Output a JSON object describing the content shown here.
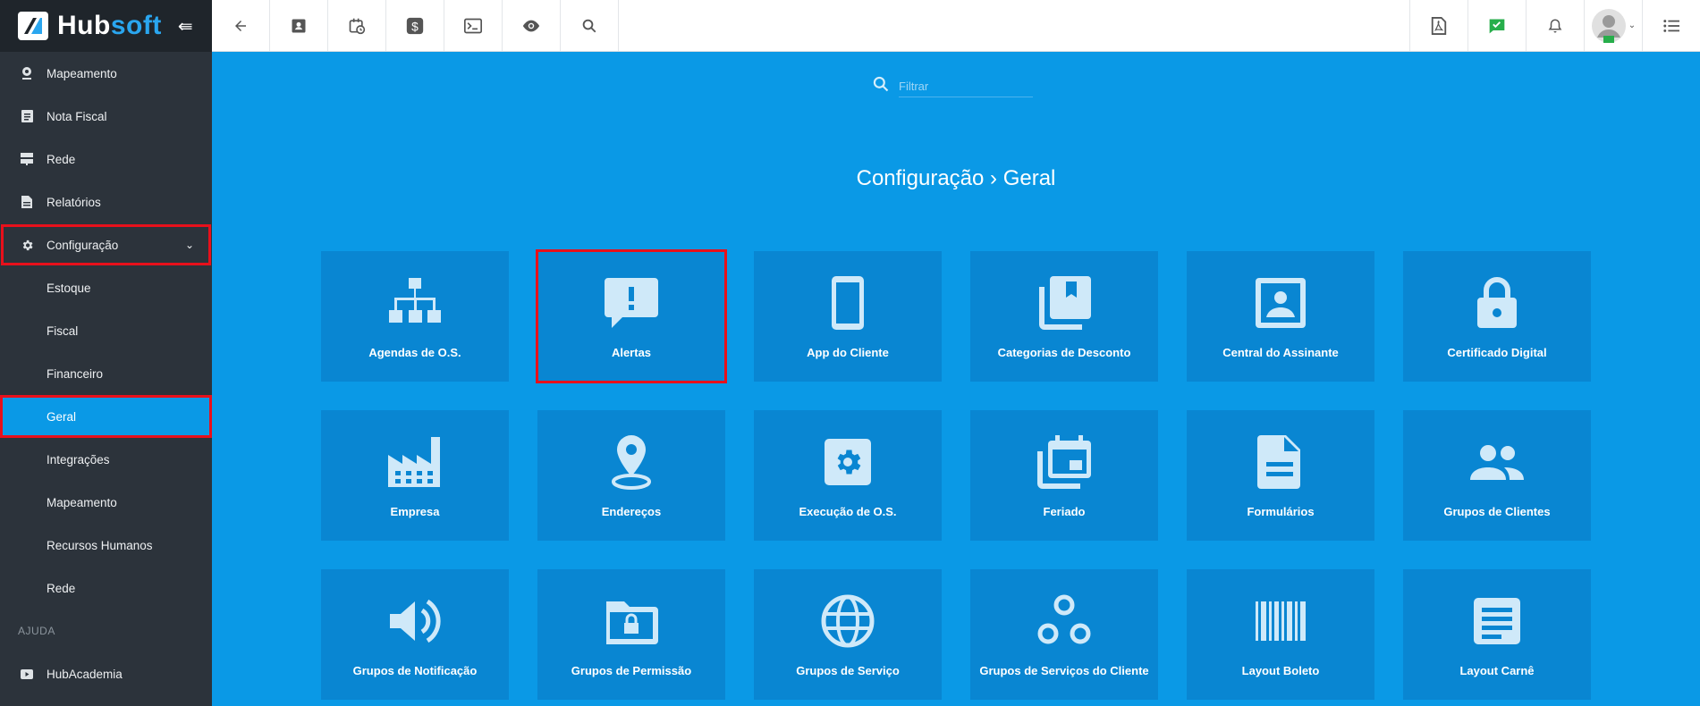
{
  "brand": {
    "name_a": "Hub",
    "name_b": "soft"
  },
  "sidebar": {
    "items": [
      {
        "label": "Mapeamento",
        "icon": "map-pin-icon"
      },
      {
        "label": "Nota Fiscal",
        "icon": "document-icon"
      },
      {
        "label": "Rede",
        "icon": "server-icon"
      },
      {
        "label": "Relatórios",
        "icon": "report-icon"
      },
      {
        "label": "Configuração",
        "icon": "gear-icon"
      }
    ],
    "subitems": [
      "Estoque",
      "Fiscal",
      "Financeiro",
      "Geral",
      "Integrações",
      "Mapeamento",
      "Recursos Humanos",
      "Rede"
    ],
    "section": "AJUDA",
    "help_items": [
      {
        "label": "HubAcademia",
        "icon": "play-icon"
      }
    ]
  },
  "topbar": {
    "left_icons": [
      "back-arrow-icon",
      "contact-card-icon",
      "calendar-clock-icon",
      "dollar-icon",
      "terminal-icon",
      "eye-icon",
      "search-icon"
    ],
    "right_icons": [
      "pdf-icon",
      "chat-check-icon",
      "bell-icon",
      "avatar",
      "list-menu-icon"
    ]
  },
  "filter": {
    "placeholder": "Filtrar"
  },
  "page": {
    "title": "Configuração › Geral"
  },
  "cards": [
    {
      "label": "Agendas de O.S.",
      "icon": "hierarchy-icon"
    },
    {
      "label": "Alertas",
      "icon": "alert-message-icon"
    },
    {
      "label": "App do Cliente",
      "icon": "smartphone-icon"
    },
    {
      "label": "Categorias de Desconto",
      "icon": "bookmark-stack-icon"
    },
    {
      "label": "Central do Assinante",
      "icon": "portrait-icon"
    },
    {
      "label": "Certificado Digital",
      "icon": "lock-icon"
    },
    {
      "label": "Empresa",
      "icon": "factory-icon"
    },
    {
      "label": "Endereços",
      "icon": "location-pin-icon"
    },
    {
      "label": "Execução de O.S.",
      "icon": "settings-box-icon"
    },
    {
      "label": "Feriado",
      "icon": "calendar-stack-icon"
    },
    {
      "label": "Formulários",
      "icon": "file-text-icon"
    },
    {
      "label": "Grupos de Clientes",
      "icon": "people-icon"
    },
    {
      "label": "Grupos de Notificação",
      "icon": "speaker-icon"
    },
    {
      "label": "Grupos de Permissão",
      "icon": "folder-lock-icon"
    },
    {
      "label": "Grupos de Serviço",
      "icon": "globe-icon"
    },
    {
      "label": "Grupos de Serviços do Cliente",
      "icon": "bubbles-icon"
    },
    {
      "label": "Layout Boleto",
      "icon": "barcode-icon"
    },
    {
      "label": "Layout Carnê",
      "icon": "text-page-icon"
    }
  ]
}
